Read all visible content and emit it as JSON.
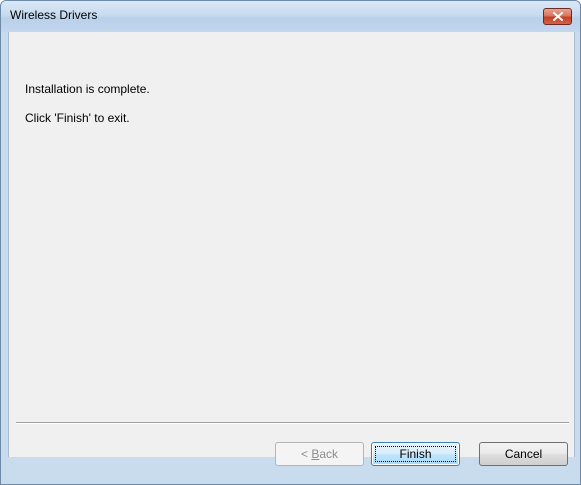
{
  "window": {
    "title": "Wireless Drivers"
  },
  "content": {
    "line1": "Installation is complete.",
    "line2": "Click 'Finish' to exit."
  },
  "buttons": {
    "back_prefix": "< ",
    "back_mnemonic": "B",
    "back_rest": "ack",
    "back_enabled": false,
    "finish_label": "Finish",
    "cancel_label": "Cancel"
  },
  "icons": {
    "close": "close-icon"
  },
  "colors": {
    "close_button": "#c33f24",
    "titlebar": "#c8dbef",
    "dialog_background": "#f0f0f0"
  }
}
